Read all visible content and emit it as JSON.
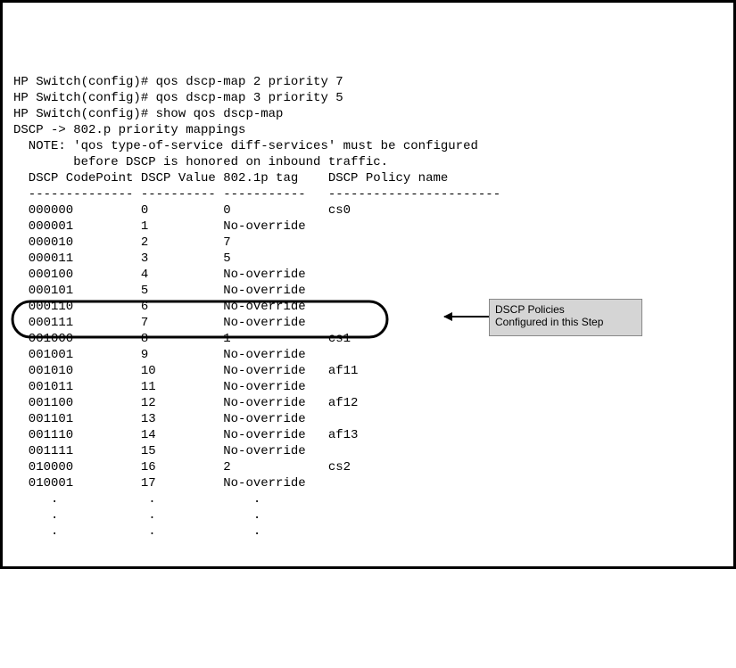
{
  "commands": [
    "HP Switch(config)# qos dscp-map 2 priority 7",
    "HP Switch(config)# qos dscp-map 3 priority 5",
    "",
    "HP Switch(config)# show qos dscp-map",
    ""
  ],
  "heading": "DSCP -> 802.p priority mappings",
  "note": {
    "line1": "  NOTE: 'qos type-of-service diff-services' must be configured",
    "line2": "        before DSCP is honored on inbound traffic."
  },
  "table": {
    "hdr_codepoint": "DSCP CodePoint",
    "hdr_value": "DSCP Value",
    "hdr_tag": "802.1p tag",
    "hdr_policy": "DSCP Policy name",
    "sep1": "--------------",
    "sep2": "----------",
    "sep3": "-----------",
    "sep4": "-----------------------",
    "rows": [
      {
        "cp": "000000",
        "val": "0",
        "tag": "0",
        "name": "cs0"
      },
      {
        "cp": "000001",
        "val": "1",
        "tag": "No-override",
        "name": ""
      },
      {
        "cp": "000010",
        "val": "2",
        "tag": "7",
        "name": ""
      },
      {
        "cp": "000011",
        "val": "3",
        "tag": "5",
        "name": ""
      },
      {
        "cp": "000100",
        "val": "4",
        "tag": "No-override",
        "name": ""
      },
      {
        "cp": "000101",
        "val": "5",
        "tag": "No-override",
        "name": ""
      },
      {
        "cp": "000110",
        "val": "6",
        "tag": "No-override",
        "name": ""
      },
      {
        "cp": "000111",
        "val": "7",
        "tag": "No-override",
        "name": ""
      },
      {
        "cp": "001000",
        "val": "8",
        "tag": "1",
        "name": "cs1"
      },
      {
        "cp": "001001",
        "val": "9",
        "tag": "No-override",
        "name": ""
      },
      {
        "cp": "001010",
        "val": "10",
        "tag": "No-override",
        "name": "af11"
      },
      {
        "cp": "001011",
        "val": "11",
        "tag": "No-override",
        "name": ""
      },
      {
        "cp": "001100",
        "val": "12",
        "tag": "No-override",
        "name": "af12"
      },
      {
        "cp": "001101",
        "val": "13",
        "tag": "No-override",
        "name": ""
      },
      {
        "cp": "001110",
        "val": "14",
        "tag": "No-override",
        "name": "af13"
      },
      {
        "cp": "001111",
        "val": "15",
        "tag": "No-override",
        "name": ""
      },
      {
        "cp": "010000",
        "val": "16",
        "tag": "2",
        "name": "cs2"
      },
      {
        "cp": "010001",
        "val": "17",
        "tag": "No-override",
        "name": ""
      }
    ],
    "ellipsis": {
      "cp": ".",
      "val": ".",
      "tag": "."
    }
  },
  "callout": {
    "line1": "DSCP Policies",
    "line2": "Configured in this Step"
  }
}
